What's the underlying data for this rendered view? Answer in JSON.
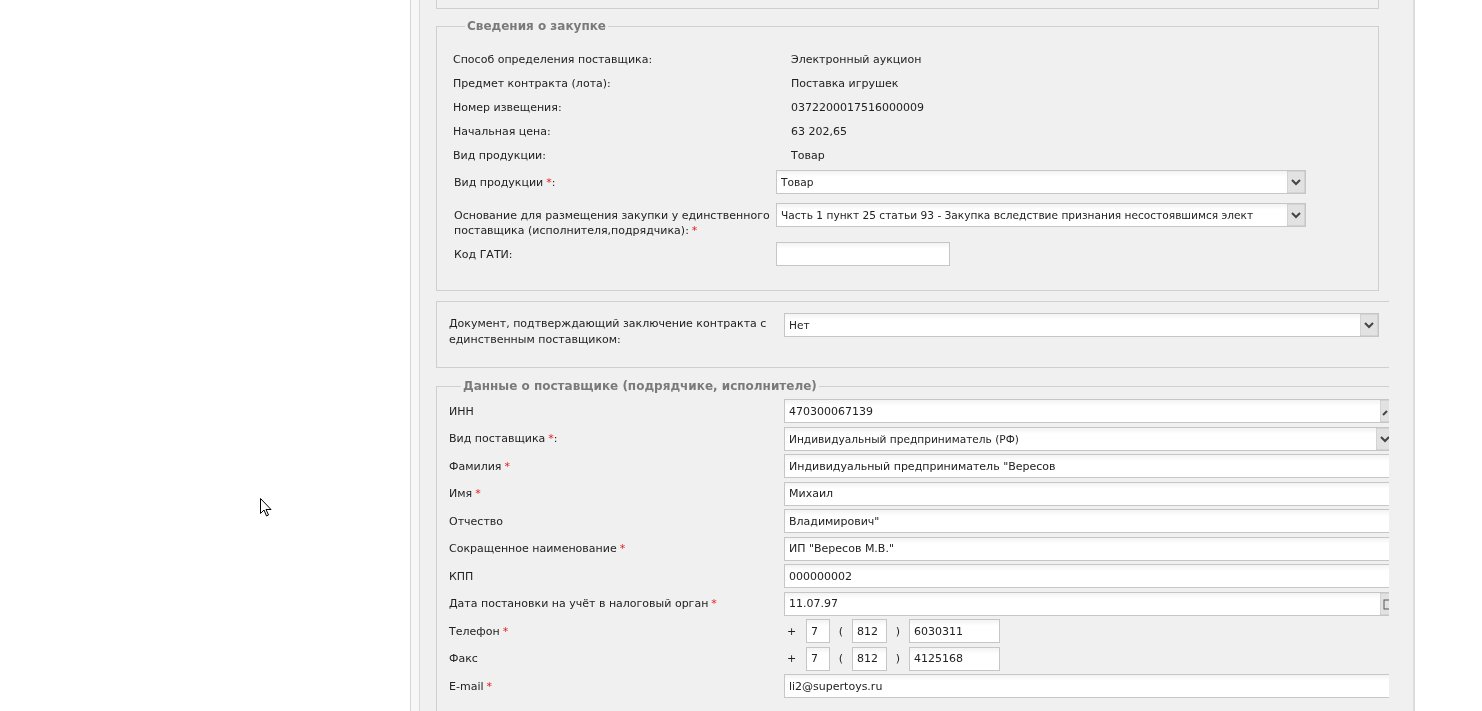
{
  "purchase_info": {
    "legend": "Сведения о закупке",
    "info_rows": [
      {
        "label": "Способ определения поставщика:",
        "value": "Электронный аукцион"
      },
      {
        "label": "Предмет контракта (лота):",
        "value": "Поставка игрушек"
      },
      {
        "label": "Номер извещения:",
        "value": "0372200017516000009"
      },
      {
        "label": "Начальная цена:",
        "value": "63 202,65"
      },
      {
        "label": "Вид продукции:",
        "value": "Товар"
      }
    ],
    "fields": [
      {
        "kind": "select",
        "label": "Вид продукции",
        "required_mark": "*",
        "after": ":",
        "value": "Товар"
      },
      {
        "kind": "select",
        "label": "Основание для размещения закупки у единственного поставщика (исполнителя,подрядчика):",
        "required_mark": "*",
        "value": "Часть 1 пункт 25 статьи 93 -  Закупка вследствие признания несостоявшимся элект"
      },
      {
        "kind": "text",
        "label": "Код ГАТИ:"
      }
    ]
  },
  "document": {
    "label": "Документ, подтверждающий заключение контракта с единственным поставщиком:",
    "value": "Нет"
  },
  "supplier": {
    "legend": "Данные о поставщике (подрядчике, исполнителе)",
    "fields": [
      {
        "kind": "lookup",
        "label": "ИНН",
        "value": "470300067139"
      },
      {
        "kind": "select",
        "label": "Вид поставщика",
        "required_mark": "*",
        "after": ":",
        "value": "Индивидуальный предприниматель (РФ)"
      },
      {
        "kind": "text",
        "label": "Фамилия",
        "required_mark": "*",
        "value": "Индивидуальный предприниматель \"Вересов"
      },
      {
        "kind": "text",
        "label": "Имя",
        "required_mark": "*",
        "value": "Михаил"
      },
      {
        "kind": "text",
        "label": "Отчество",
        "value": "Владимирович\""
      },
      {
        "kind": "text",
        "label": "Сокращенное наименование",
        "required_mark": "*",
        "value": "ИП \"Вересов М.В.\""
      },
      {
        "kind": "text",
        "label": "КПП",
        "value": "000000002"
      },
      {
        "kind": "date",
        "label": "Дата постановки на учёт в налоговый орган",
        "required_mark": "*",
        "value": "11.07.97"
      },
      {
        "kind": "phone",
        "label": "Телефон",
        "required_mark": "*",
        "plus": "+",
        "country": "7",
        "open": "(",
        "area": "812",
        "close": ")",
        "number": "6030311"
      },
      {
        "kind": "phone",
        "label": "Факс",
        "plus": "+",
        "country": "7",
        "open": "(",
        "area": "812",
        "close": ")",
        "number": "4125168"
      },
      {
        "kind": "text",
        "label": "E-mail",
        "required_mark": "*",
        "value": "li2@supertoys.ru"
      }
    ]
  }
}
